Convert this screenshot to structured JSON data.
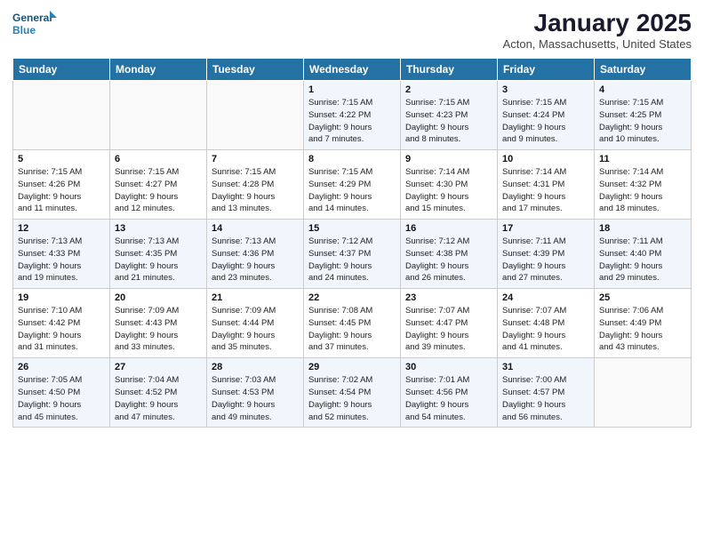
{
  "header": {
    "logo_line1": "General",
    "logo_line2": "Blue",
    "month_title": "January 2025",
    "location": "Acton, Massachusetts, United States"
  },
  "weekdays": [
    "Sunday",
    "Monday",
    "Tuesday",
    "Wednesday",
    "Thursday",
    "Friday",
    "Saturday"
  ],
  "rows": [
    [
      {
        "day": "",
        "info": ""
      },
      {
        "day": "",
        "info": ""
      },
      {
        "day": "",
        "info": ""
      },
      {
        "day": "1",
        "info": "Sunrise: 7:15 AM\nSunset: 4:22 PM\nDaylight: 9 hours\nand 7 minutes."
      },
      {
        "day": "2",
        "info": "Sunrise: 7:15 AM\nSunset: 4:23 PM\nDaylight: 9 hours\nand 8 minutes."
      },
      {
        "day": "3",
        "info": "Sunrise: 7:15 AM\nSunset: 4:24 PM\nDaylight: 9 hours\nand 9 minutes."
      },
      {
        "day": "4",
        "info": "Sunrise: 7:15 AM\nSunset: 4:25 PM\nDaylight: 9 hours\nand 10 minutes."
      }
    ],
    [
      {
        "day": "5",
        "info": "Sunrise: 7:15 AM\nSunset: 4:26 PM\nDaylight: 9 hours\nand 11 minutes."
      },
      {
        "day": "6",
        "info": "Sunrise: 7:15 AM\nSunset: 4:27 PM\nDaylight: 9 hours\nand 12 minutes."
      },
      {
        "day": "7",
        "info": "Sunrise: 7:15 AM\nSunset: 4:28 PM\nDaylight: 9 hours\nand 13 minutes."
      },
      {
        "day": "8",
        "info": "Sunrise: 7:15 AM\nSunset: 4:29 PM\nDaylight: 9 hours\nand 14 minutes."
      },
      {
        "day": "9",
        "info": "Sunrise: 7:14 AM\nSunset: 4:30 PM\nDaylight: 9 hours\nand 15 minutes."
      },
      {
        "day": "10",
        "info": "Sunrise: 7:14 AM\nSunset: 4:31 PM\nDaylight: 9 hours\nand 17 minutes."
      },
      {
        "day": "11",
        "info": "Sunrise: 7:14 AM\nSunset: 4:32 PM\nDaylight: 9 hours\nand 18 minutes."
      }
    ],
    [
      {
        "day": "12",
        "info": "Sunrise: 7:13 AM\nSunset: 4:33 PM\nDaylight: 9 hours\nand 19 minutes."
      },
      {
        "day": "13",
        "info": "Sunrise: 7:13 AM\nSunset: 4:35 PM\nDaylight: 9 hours\nand 21 minutes."
      },
      {
        "day": "14",
        "info": "Sunrise: 7:13 AM\nSunset: 4:36 PM\nDaylight: 9 hours\nand 23 minutes."
      },
      {
        "day": "15",
        "info": "Sunrise: 7:12 AM\nSunset: 4:37 PM\nDaylight: 9 hours\nand 24 minutes."
      },
      {
        "day": "16",
        "info": "Sunrise: 7:12 AM\nSunset: 4:38 PM\nDaylight: 9 hours\nand 26 minutes."
      },
      {
        "day": "17",
        "info": "Sunrise: 7:11 AM\nSunset: 4:39 PM\nDaylight: 9 hours\nand 27 minutes."
      },
      {
        "day": "18",
        "info": "Sunrise: 7:11 AM\nSunset: 4:40 PM\nDaylight: 9 hours\nand 29 minutes."
      }
    ],
    [
      {
        "day": "19",
        "info": "Sunrise: 7:10 AM\nSunset: 4:42 PM\nDaylight: 9 hours\nand 31 minutes."
      },
      {
        "day": "20",
        "info": "Sunrise: 7:09 AM\nSunset: 4:43 PM\nDaylight: 9 hours\nand 33 minutes."
      },
      {
        "day": "21",
        "info": "Sunrise: 7:09 AM\nSunset: 4:44 PM\nDaylight: 9 hours\nand 35 minutes."
      },
      {
        "day": "22",
        "info": "Sunrise: 7:08 AM\nSunset: 4:45 PM\nDaylight: 9 hours\nand 37 minutes."
      },
      {
        "day": "23",
        "info": "Sunrise: 7:07 AM\nSunset: 4:47 PM\nDaylight: 9 hours\nand 39 minutes."
      },
      {
        "day": "24",
        "info": "Sunrise: 7:07 AM\nSunset: 4:48 PM\nDaylight: 9 hours\nand 41 minutes."
      },
      {
        "day": "25",
        "info": "Sunrise: 7:06 AM\nSunset: 4:49 PM\nDaylight: 9 hours\nand 43 minutes."
      }
    ],
    [
      {
        "day": "26",
        "info": "Sunrise: 7:05 AM\nSunset: 4:50 PM\nDaylight: 9 hours\nand 45 minutes."
      },
      {
        "day": "27",
        "info": "Sunrise: 7:04 AM\nSunset: 4:52 PM\nDaylight: 9 hours\nand 47 minutes."
      },
      {
        "day": "28",
        "info": "Sunrise: 7:03 AM\nSunset: 4:53 PM\nDaylight: 9 hours\nand 49 minutes."
      },
      {
        "day": "29",
        "info": "Sunrise: 7:02 AM\nSunset: 4:54 PM\nDaylight: 9 hours\nand 52 minutes."
      },
      {
        "day": "30",
        "info": "Sunrise: 7:01 AM\nSunset: 4:56 PM\nDaylight: 9 hours\nand 54 minutes."
      },
      {
        "day": "31",
        "info": "Sunrise: 7:00 AM\nSunset: 4:57 PM\nDaylight: 9 hours\nand 56 minutes."
      },
      {
        "day": "",
        "info": ""
      }
    ]
  ]
}
